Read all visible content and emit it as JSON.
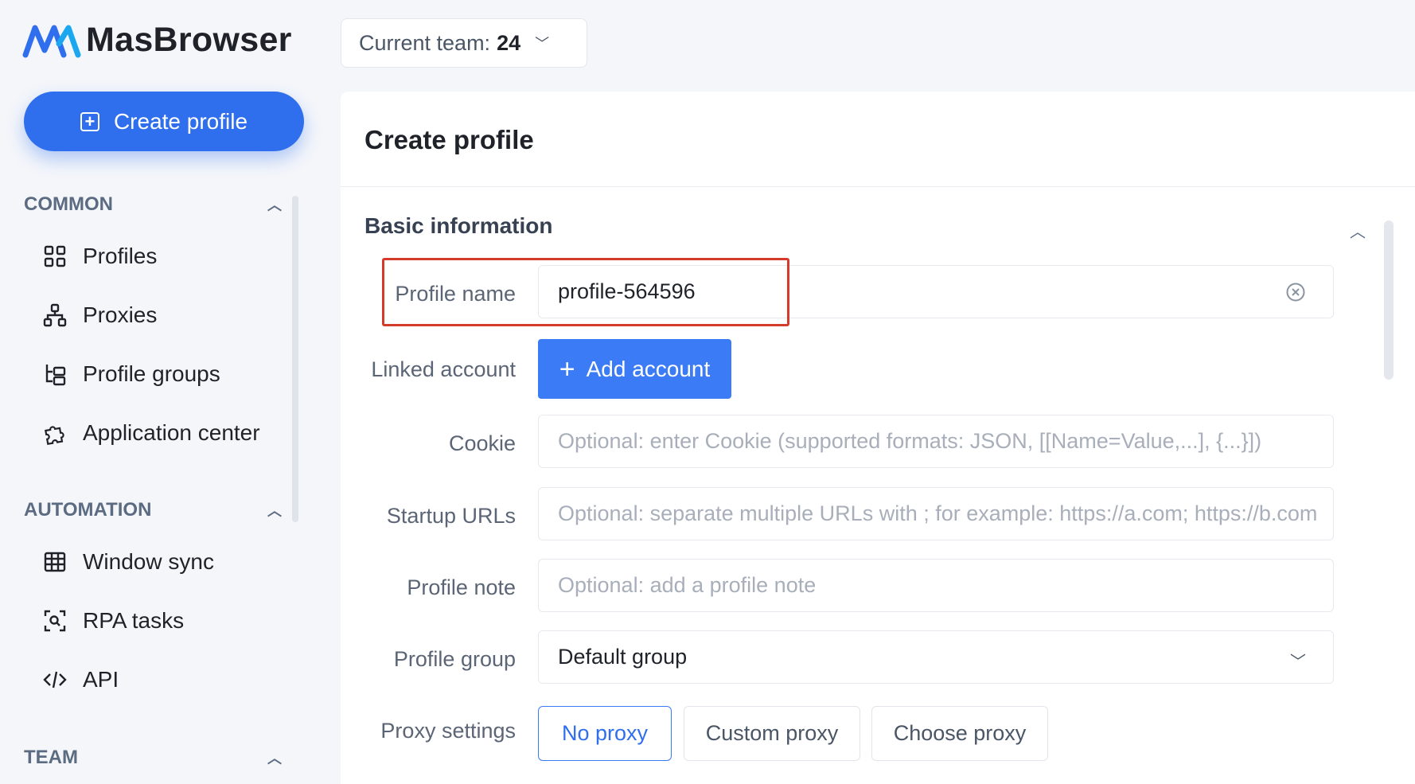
{
  "app": {
    "name": "MasBrowser",
    "brand_color": "#2f6fee"
  },
  "sidebar": {
    "create_button": "Create profile",
    "sections": [
      {
        "title": "COMMON",
        "items": [
          "Profiles",
          "Proxies",
          "Profile groups",
          "Application center"
        ]
      },
      {
        "title": "AUTOMATION",
        "items": [
          "Window sync",
          "RPA tasks",
          "API"
        ]
      },
      {
        "title": "TEAM",
        "items": []
      }
    ],
    "icons": [
      "grid-icon",
      "network-icon",
      "folder-tree-icon",
      "puzzle-icon",
      "table-icon",
      "scan-icon",
      "code-icon"
    ]
  },
  "topbar": {
    "team_label": "Current team:",
    "team_value": "24"
  },
  "main": {
    "title": "Create profile",
    "section_title": "Basic information",
    "fields": {
      "profile_name": {
        "label": "Profile name",
        "value": "profile-564596"
      },
      "linked_account": {
        "label": "Linked account",
        "button": "Add account"
      },
      "cookie": {
        "label": "Cookie",
        "placeholder": "Optional: enter Cookie (supported formats: JSON, [[Name=Value,...], {...}])"
      },
      "startup_urls": {
        "label": "Startup URLs",
        "placeholder": "Optional: separate multiple URLs with ; for example: https://a.com; https://b.com"
      },
      "profile_note": {
        "label": "Profile note",
        "placeholder": "Optional: add a profile note"
      },
      "profile_group": {
        "label": "Profile group",
        "value": "Default group"
      },
      "proxy_settings": {
        "label": "Proxy settings",
        "options": [
          "No proxy",
          "Custom proxy",
          "Choose proxy"
        ],
        "selected": "No proxy"
      }
    },
    "highlight_color": "#d43b2a"
  }
}
